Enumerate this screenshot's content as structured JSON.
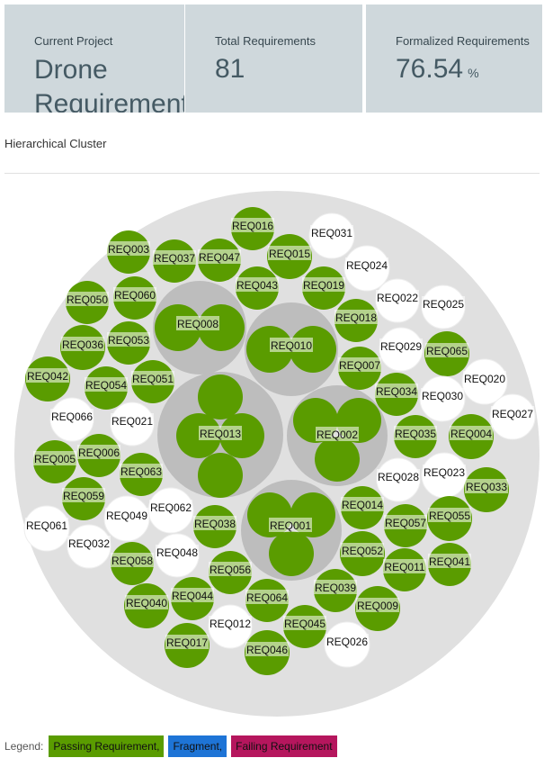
{
  "stats": {
    "project_label": "Current Project",
    "project_value": "Drone Requirements",
    "total_label": "Total Requirements",
    "total_value": "81",
    "formalized_label": "Formalized Requirements",
    "formalized_value": "76.54",
    "formalized_unit": "%"
  },
  "section_title": "Hierarchical Cluster",
  "colors": {
    "outer": "#e0e0e0",
    "group": "#bdbdbd",
    "passing": "#5a9c00",
    "fragment": "#1e74d6",
    "failing": "#b5165d",
    "white_node": "#ffffff"
  },
  "legend": {
    "title": "Legend:",
    "items": [
      {
        "label": "Passing Requirement,",
        "color": "#5a9c00"
      },
      {
        "label": "Fragment,",
        "color": "#1e74d6"
      },
      {
        "label": "Failing Requirement",
        "color": "#b5165d"
      }
    ]
  },
  "groups": [
    {
      "label": "REQ008",
      "children": [
        "REQ008",
        "REQ008"
      ]
    },
    {
      "label": "REQ010",
      "children": [
        "REQ010",
        "REQ010"
      ]
    },
    {
      "label": "REQ013",
      "children": [
        "REQ013",
        "REQ013",
        "REQ013",
        "REQ013"
      ]
    },
    {
      "label": "REQ002",
      "children": [
        "REQ002",
        "REQ002",
        "REQ002"
      ]
    },
    {
      "label": "REQ001",
      "children": [
        "REQ001",
        "REQ001",
        "REQ001"
      ]
    }
  ],
  "nodes": [
    {
      "label": "REQ016",
      "status": "pass"
    },
    {
      "label": "REQ031",
      "status": "white"
    },
    {
      "label": "REQ003",
      "status": "pass"
    },
    {
      "label": "REQ037",
      "status": "pass"
    },
    {
      "label": "REQ047",
      "status": "pass"
    },
    {
      "label": "REQ015",
      "status": "pass"
    },
    {
      "label": "REQ024",
      "status": "white"
    },
    {
      "label": "REQ043",
      "status": "pass"
    },
    {
      "label": "REQ019",
      "status": "pass"
    },
    {
      "label": "REQ050",
      "status": "pass"
    },
    {
      "label": "REQ060",
      "status": "pass"
    },
    {
      "label": "REQ022",
      "status": "white"
    },
    {
      "label": "REQ025",
      "status": "white"
    },
    {
      "label": "REQ018",
      "status": "pass"
    },
    {
      "label": "REQ036",
      "status": "pass"
    },
    {
      "label": "REQ053",
      "status": "pass"
    },
    {
      "label": "REQ029",
      "status": "white"
    },
    {
      "label": "REQ065",
      "status": "pass"
    },
    {
      "label": "REQ007",
      "status": "pass"
    },
    {
      "label": "REQ042",
      "status": "pass"
    },
    {
      "label": "REQ054",
      "status": "pass"
    },
    {
      "label": "REQ051",
      "status": "pass"
    },
    {
      "label": "REQ020",
      "status": "white"
    },
    {
      "label": "REQ034",
      "status": "pass"
    },
    {
      "label": "REQ030",
      "status": "white"
    },
    {
      "label": "REQ066",
      "status": "white"
    },
    {
      "label": "REQ021",
      "status": "white"
    },
    {
      "label": "REQ027",
      "status": "white"
    },
    {
      "label": "REQ004",
      "status": "pass"
    },
    {
      "label": "REQ035",
      "status": "pass"
    },
    {
      "label": "REQ006",
      "status": "pass"
    },
    {
      "label": "REQ005",
      "status": "pass"
    },
    {
      "label": "REQ063",
      "status": "pass"
    },
    {
      "label": "REQ023",
      "status": "white"
    },
    {
      "label": "REQ028",
      "status": "white"
    },
    {
      "label": "REQ033",
      "status": "pass"
    },
    {
      "label": "REQ059",
      "status": "pass"
    },
    {
      "label": "REQ062",
      "status": "white"
    },
    {
      "label": "REQ049",
      "status": "white"
    },
    {
      "label": "REQ014",
      "status": "pass"
    },
    {
      "label": "REQ061",
      "status": "white"
    },
    {
      "label": "REQ038",
      "status": "pass"
    },
    {
      "label": "REQ057",
      "status": "pass"
    },
    {
      "label": "REQ055",
      "status": "pass"
    },
    {
      "label": "REQ032",
      "status": "white"
    },
    {
      "label": "REQ048",
      "status": "white"
    },
    {
      "label": "REQ058",
      "status": "pass"
    },
    {
      "label": "REQ052",
      "status": "pass"
    },
    {
      "label": "REQ011",
      "status": "pass"
    },
    {
      "label": "REQ041",
      "status": "pass"
    },
    {
      "label": "REQ056",
      "status": "pass"
    },
    {
      "label": "REQ039",
      "status": "pass"
    },
    {
      "label": "REQ040",
      "status": "pass"
    },
    {
      "label": "REQ044",
      "status": "pass"
    },
    {
      "label": "REQ064",
      "status": "pass"
    },
    {
      "label": "REQ009",
      "status": "pass"
    },
    {
      "label": "REQ012",
      "status": "white"
    },
    {
      "label": "REQ045",
      "status": "pass"
    },
    {
      "label": "REQ017",
      "status": "pass"
    },
    {
      "label": "REQ046",
      "status": "pass"
    },
    {
      "label": "REQ026",
      "status": "white"
    }
  ]
}
